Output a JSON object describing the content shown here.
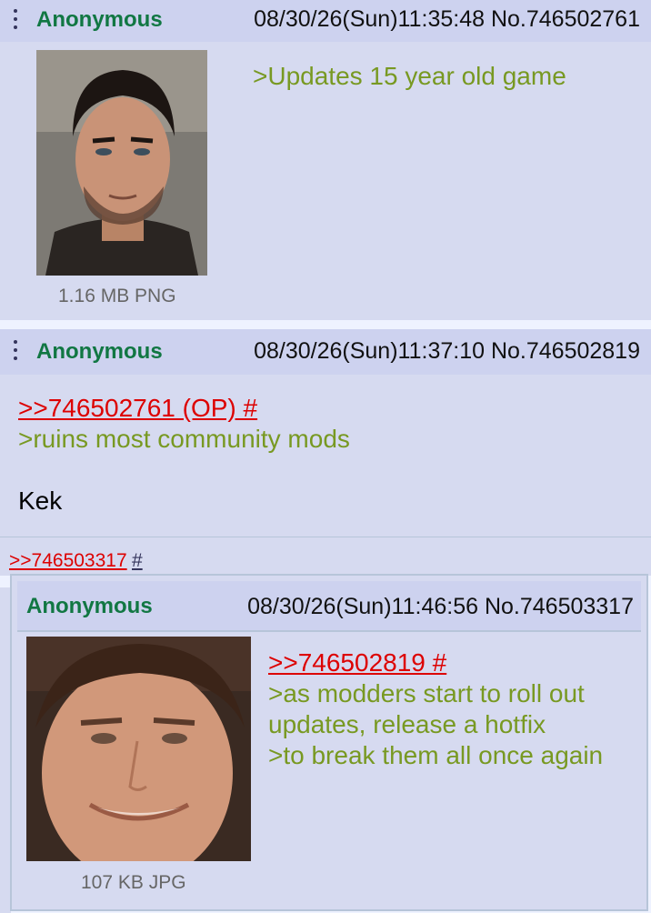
{
  "posts": [
    {
      "name": "Anonymous",
      "datetime": "08/30/26(Sun)11:35:48",
      "number": "No.746502761",
      "body_line1": ">Updates 15 year old game",
      "file_info": "1.16 MB PNG"
    },
    {
      "name": "Anonymous",
      "datetime": "08/30/26(Sun)11:37:10",
      "number": "No.746502819",
      "quote_link": ">>746502761 (OP) #",
      "body_line1": ">ruins most community mods",
      "body_line2": "Kek"
    }
  ],
  "backlink": {
    "link": ">>746503317",
    "hash": "#"
  },
  "preview": {
    "name": "Anonymous",
    "datetime": "08/30/26(Sun)11:46:56",
    "number": "No.746503317",
    "quote_link": ">>746502819 #",
    "line1": ">as modders start to roll out",
    "line2": "updates, release a hotfix",
    "line3": ">to break them all once again",
    "file_info": "107 KB JPG"
  },
  "colors": {
    "name": "#117743",
    "greentext": "#789922",
    "quotelink": "#dd0000",
    "post_bg": "#d6daf0",
    "page_bg": "#eef2ff"
  }
}
